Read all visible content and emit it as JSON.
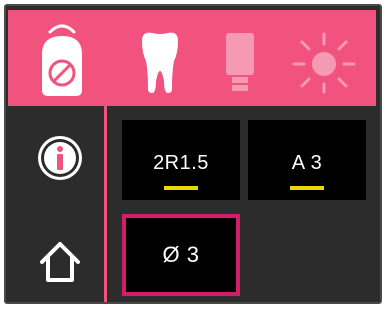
{
  "colors": {
    "accent": "#f2537e",
    "selected_border": "#d21e6a",
    "indicator": "#e6d800",
    "panel_bg": "#2c2c2c",
    "tile_bg": "#000000"
  },
  "header": {
    "mode_icon": "tip-sleeve-icon",
    "tabs": [
      {
        "icon": "tooth-icon",
        "active": true
      },
      {
        "icon": "tip-icon",
        "active": false
      },
      {
        "icon": "light-icon",
        "active": false
      }
    ]
  },
  "sidebar": {
    "items": [
      {
        "icon": "info-icon"
      },
      {
        "icon": "home-icon"
      }
    ]
  },
  "settings": {
    "tiles": [
      {
        "label": "2R1.5",
        "has_indicator": true
      },
      {
        "label": "A 3",
        "has_indicator": true
      },
      {
        "label": "Ø 3",
        "has_indicator": false,
        "selected": true
      }
    ]
  }
}
